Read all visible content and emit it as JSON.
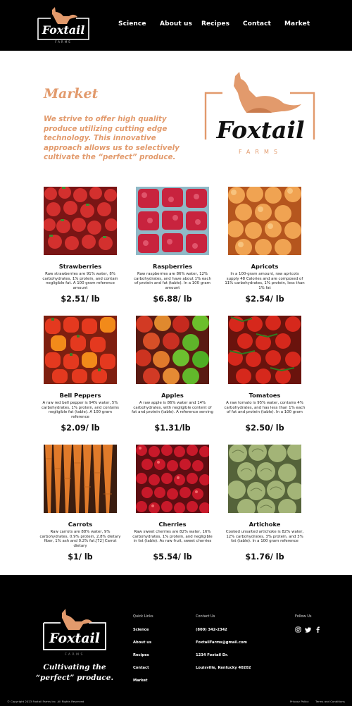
{
  "header": {
    "logo_text": "Foxtail",
    "nav": [
      "Science",
      "About us",
      "Recipes",
      "Contact",
      "Market"
    ]
  },
  "hero": {
    "title": "Market",
    "intro": "We strive to offer high quality produce utilizing cutting edge technology. This innovative approach allows us to selectively cultivate the “perfect” produce.",
    "logo_word": "Foxtail",
    "logo_sub": "FARMS"
  },
  "products": [
    {
      "name": "Strawberries",
      "desc": "Raw strawberries are 91% water, 8% carbohydrates, 1% protein, and contain negligible fat. A 100 gram reference amount",
      "price": "$2.51/ lb",
      "icon": "strawberries-photo"
    },
    {
      "name": "Raspberries",
      "desc": "Raw raspberries are 86% water, 12% carbohydrates, and have about 1% each of protein and fat (table). In a 100 gram amount",
      "price": "$6.88/ lb",
      "icon": "raspberries-photo"
    },
    {
      "name": "Apricots",
      "desc": "In a 100-gram amount, raw apricots supply 48 Calories and are composed of 11% carbohydrates, 1% protein, less than 1% fat",
      "price": "$2.54/ lb",
      "icon": "apricots-photo"
    },
    {
      "name": "Bell Peppers",
      "desc": "A raw red bell pepper is 94% water, 5% carbohydrates, 1% protein, and contains negligible fat (table). A 100 gram reference",
      "price": "$2.09/ lb",
      "icon": "bell-peppers-photo"
    },
    {
      "name": "Apples",
      "desc": "A raw apple is 86% water and 14% carbohydrates, with negligible content of fat and protein (table). A reference serving",
      "price": "$1.31/lb",
      "icon": "apples-photo"
    },
    {
      "name": "Tomatoes",
      "desc": "A raw tomato is 95% water, contains 4% carbohydrates, and has less than 1% each of fat and protein (table). In a 100 gram",
      "price": "$2.50/ lb",
      "icon": "tomatoes-photo"
    },
    {
      "name": "Carrots",
      "desc": "Raw carrots are 88% water, 9% carbohydrates, 0.9% protein, 2.8% dietary fiber, 1% ash and 0.2% fat.[72] Carrot dietary",
      "price": "$1/ lb",
      "icon": "carrots-photo"
    },
    {
      "name": "Cherries",
      "desc": "Raw sweet cherries are 82% water, 16% carbohydrates, 1% protein, and negligible in fat (table). As raw fruit, sweet cherries",
      "price": "$5.54/ lb",
      "icon": "cherries-photo"
    },
    {
      "name": "Artichoke",
      "desc": "Cooked unsalted artichoke is 82% water, 12% carbohydrates, 3% protein, and 3% fat (table). In a 100 gram reference",
      "price": "$1.76/ lb",
      "icon": "artichoke-photo"
    }
  ],
  "footer": {
    "logo_text": "Foxtail",
    "tagline_1": "Cultivating the",
    "tagline_2": "“perfect” produce.",
    "quick_links_heading": "Quick Links",
    "quick_links": [
      "Science",
      "About us",
      "Recipes",
      "Contact",
      "Market"
    ],
    "contact_heading": "Contact Us",
    "phone": "(800) 342-2342",
    "email": "FoxtailFarms@gmail.com",
    "address_1": "1234 Foxtail Dr.",
    "address_2": "Louisville, Kentucky 40202",
    "follow_heading": "Follow Us",
    "social_icons": [
      "instagram-icon",
      "twitter-icon",
      "facebook-icon"
    ],
    "copyright": "© Copyright 2023 Foxtail Farms Inc. All Rights Reserved",
    "privacy": "Privacy Policy",
    "terms": "Terms and Conditions"
  },
  "colors": {
    "accent": "#e29a6c",
    "black": "#000000"
  }
}
